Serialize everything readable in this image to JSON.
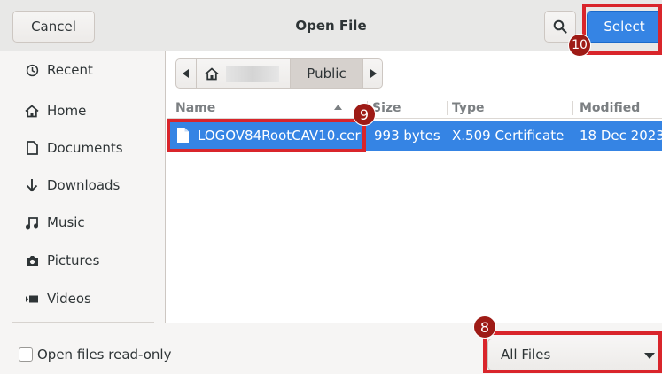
{
  "header": {
    "cancel_label": "Cancel",
    "title": "Open File",
    "search_icon": "search-icon",
    "select_label": "Select",
    "accent": "#3584e4"
  },
  "sidebar": {
    "items": [
      {
        "label": "Recent",
        "icon": "clock-icon"
      },
      {
        "label": "Home",
        "icon": "home-icon"
      },
      {
        "label": "Documents",
        "icon": "document-icon"
      },
      {
        "label": "Downloads",
        "icon": "download-arrow-icon"
      },
      {
        "label": "Music",
        "icon": "music-note-icon"
      },
      {
        "label": "Pictures",
        "icon": "camera-icon"
      },
      {
        "label": "Videos",
        "icon": "video-icon"
      }
    ]
  },
  "pathbar": {
    "current": "Public"
  },
  "filelist": {
    "columns": [
      "Name",
      "Size",
      "Type",
      "Modified"
    ],
    "rows": [
      {
        "name": "LOGOV84RootCAV10.cer",
        "size": "993 bytes",
        "type": "X.509 Certificate",
        "modified": "18 Dec 2023",
        "selected": true
      }
    ]
  },
  "footer": {
    "readonly_label": "Open files read-only",
    "readonly_checked": false,
    "filter_value": "All Files"
  },
  "annotations": {
    "badge_8": "8",
    "badge_9": "9",
    "badge_10": "10",
    "highlight_color": "#d9252b"
  }
}
